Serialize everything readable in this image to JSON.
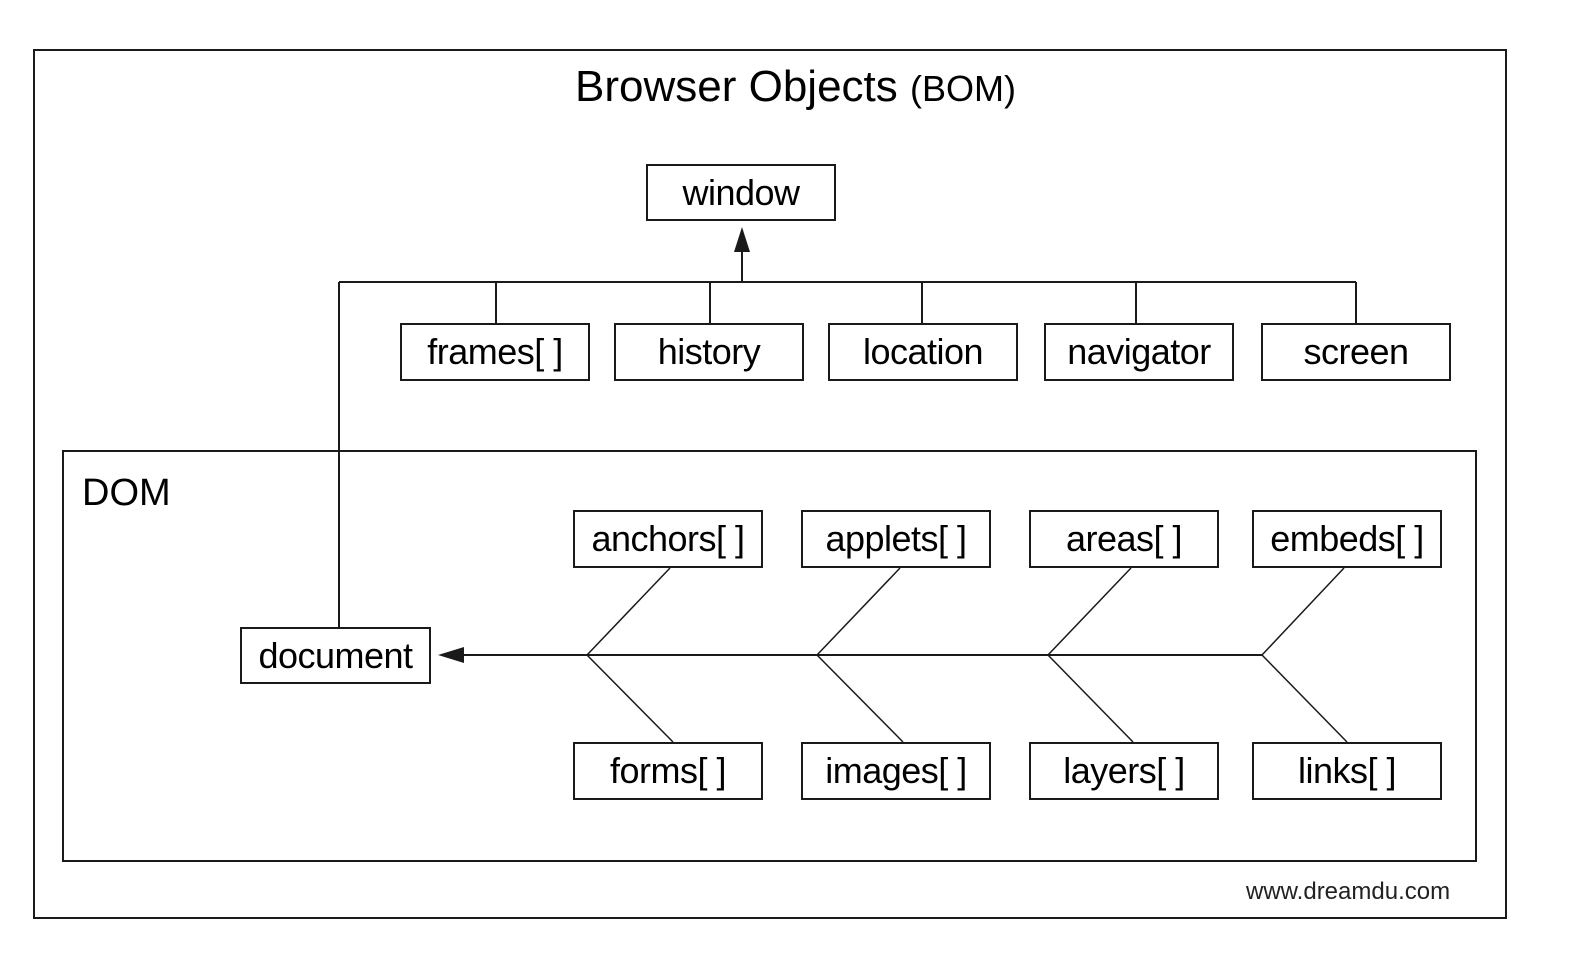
{
  "title": {
    "main": "Browser Objects",
    "suffix": "(BOM)"
  },
  "dom_label": "DOM",
  "root": "window",
  "bom_children": [
    "frames[ ]",
    "history",
    "location",
    "navigator",
    "screen"
  ],
  "document": "document",
  "dom_top": [
    "anchors[ ]",
    "applets[ ]",
    "areas[ ]",
    "embeds[ ]"
  ],
  "dom_bottom": [
    "forms[ ]",
    "images[ ]",
    "layers[ ]",
    "links[ ]"
  ],
  "credit": "www.dreamdu.com",
  "colors": {
    "line": "#1a1a1a",
    "background": "#ffffff"
  }
}
